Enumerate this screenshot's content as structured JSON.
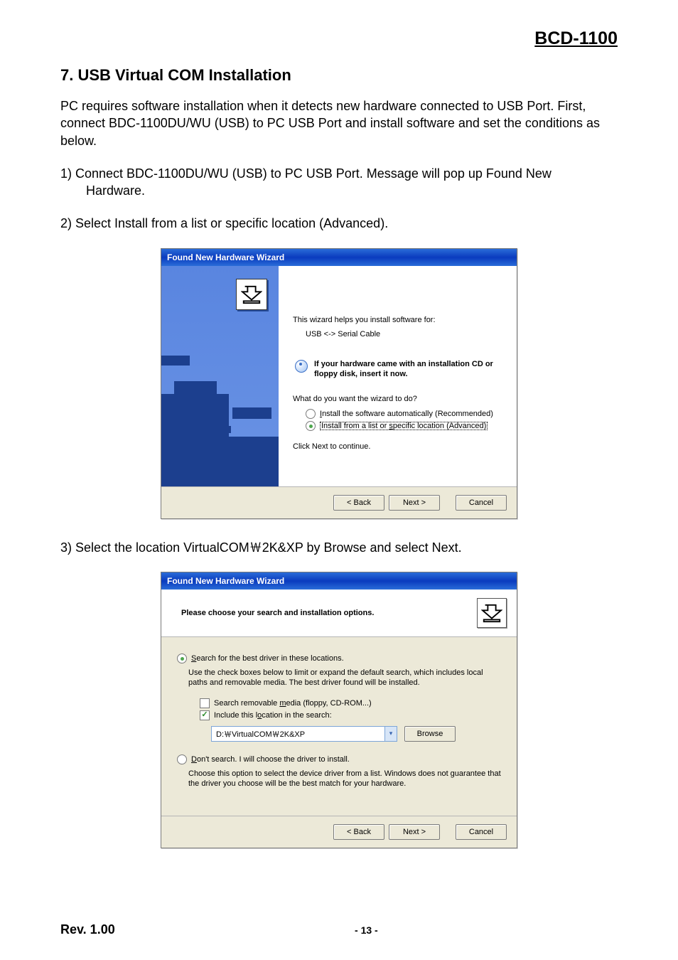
{
  "doc": {
    "product": "BCD-1100",
    "section_title": "7. USB Virtual COM Installation",
    "intro": "PC requires software installation when it detects new hardware connected to USB Port. First, connect BDC-1100DU/WU (USB) to PC USB Port and install software and set the conditions as below.",
    "step1_a": "1) Connect BDC-1100DU/WU (USB) to PC USB Port. Message will pop up Found New",
    "step1_b": "Hardware.",
    "step2": "2) Select Install from a list or specific location (Advanced).",
    "step3": "3) Select the location VirtualCOM￦2K&XP by Browse and select Next.",
    "rev": "Rev. 1.00",
    "page": "- 13 -"
  },
  "wiz1": {
    "title": "Found New Hardware Wizard",
    "line1": "This wizard helps you install software for:",
    "device": "USB <-> Serial Cable",
    "info": "If your hardware came with an installation CD or floppy disk, insert it now.",
    "prompt": "What do you want the wizard to do?",
    "opt_auto_pre": "I",
    "opt_auto_rest": "nstall the software automatically (Recommended)",
    "opt_list_pre": "Install from a list or ",
    "opt_list_u": "s",
    "opt_list_rest": "pecific location (Advanced)",
    "continue": "Click Next to continue.",
    "btn_back": "< Back",
    "btn_next": "Next >",
    "btn_cancel": "Cancel"
  },
  "wiz2": {
    "title": "Found New Hardware Wizard",
    "header": "Please choose your search and installation options.",
    "opt_search_pre": "S",
    "opt_search_rest": "earch for the best driver in these locations.",
    "search_help": "Use the check boxes below to limit or expand the default search, which includes local paths and removable media. The best driver found will be installed.",
    "chk_media_pre": "Search removable ",
    "chk_media_u": "m",
    "chk_media_rest": "edia (floppy, CD-ROM...)",
    "chk_loc_pre": "Include this l",
    "chk_loc_u": "o",
    "chk_loc_rest": "cation in the search:",
    "path": "D:￦VirtualCOM￦2K&XP",
    "browse": "Browse",
    "opt_dont_pre": "D",
    "opt_dont_rest": "on't search. I will choose the driver to install.",
    "dont_help": "Choose this option to select the device driver from a list.  Windows does not guarantee that the driver you choose will be the best match for your hardware.",
    "btn_back": "< Back",
    "btn_next": "Next >",
    "btn_cancel": "Cancel"
  }
}
